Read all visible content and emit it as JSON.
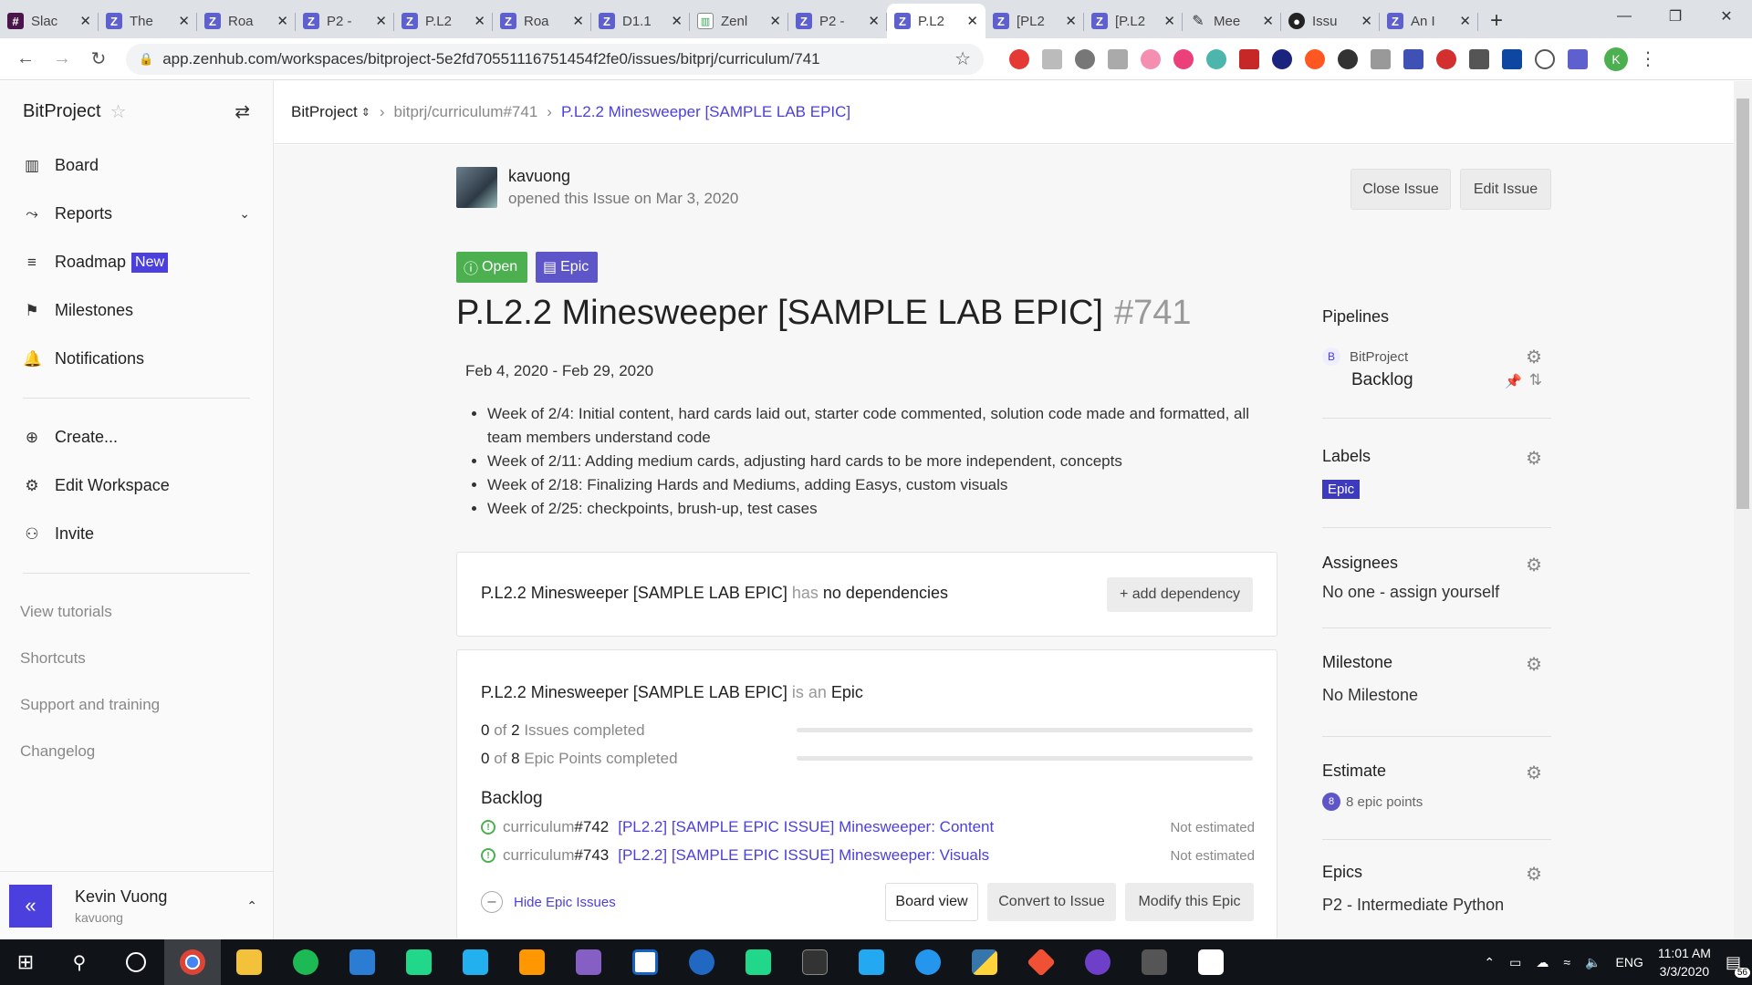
{
  "browser": {
    "tabs": [
      {
        "title": "Slac",
        "icon": "slack-icon"
      },
      {
        "title": "The",
        "icon": "zenhub-icon"
      },
      {
        "title": "Roa",
        "icon": "zenhub-icon"
      },
      {
        "title": "P2 -",
        "icon": "zenhub-icon"
      },
      {
        "title": "P.L2",
        "icon": "zenhub-icon"
      },
      {
        "title": "Roa",
        "icon": "zenhub-icon"
      },
      {
        "title": "D1.1",
        "icon": "zenhub-icon"
      },
      {
        "title": "Zenl",
        "icon": "chart-icon"
      },
      {
        "title": "P2 -",
        "icon": "zenhub-icon"
      },
      {
        "title": "P.L2",
        "icon": "zenhub-icon",
        "active": true
      },
      {
        "title": "[PL2",
        "icon": "zenhub-icon"
      },
      {
        "title": "[P.L2",
        "icon": "zenhub-icon"
      },
      {
        "title": "Mee",
        "icon": "pencil-icon"
      },
      {
        "title": "Issu",
        "icon": "github-icon"
      },
      {
        "title": "An I",
        "icon": "zenhub-icon"
      }
    ],
    "url": "app.zenhub.com/workspaces/bitproject-5e2fd70551116751454f2fe0/issues/bitprj/curriculum/741",
    "profile_initial": "K"
  },
  "sidebar": {
    "workspace": "BitProject",
    "nav": [
      {
        "label": "Board",
        "icon": "board-icon"
      },
      {
        "label": "Reports",
        "icon": "reports-icon"
      },
      {
        "label": "Roadmap",
        "icon": "roadmap-icon",
        "badge": "New"
      },
      {
        "label": "Milestones",
        "icon": "milestone-icon"
      },
      {
        "label": "Notifications",
        "icon": "bell-icon"
      }
    ],
    "actions": [
      {
        "label": "Create...",
        "icon": "plus-circle-icon"
      },
      {
        "label": "Edit Workspace",
        "icon": "gear-icon"
      },
      {
        "label": "Invite",
        "icon": "add-person-icon"
      }
    ],
    "links": [
      "View tutorials",
      "Shortcuts",
      "Support and training",
      "Changelog"
    ],
    "user": {
      "name": "Kevin Vuong",
      "handle": "kavuong"
    }
  },
  "breadcrumb": {
    "workspace": "BitProject",
    "repo": "bitprj/curriculum#741",
    "issue": "P.L2.2 Minesweeper [SAMPLE LAB EPIC]"
  },
  "issue": {
    "author": "kavuong",
    "opened": "opened this Issue on Mar 3, 2020",
    "close_btn": "Close Issue",
    "edit_btn": "Edit Issue",
    "status": "Open",
    "type": "Epic",
    "title": "P.L2.2 Minesweeper [SAMPLE LAB EPIC]",
    "number": "#741",
    "dates": "Feb 4, 2020 - Feb 29, 2020",
    "body": [
      "Week of 2/4: Initial content, hard cards laid out, starter code commented, solution code made and formatted, all team members understand code",
      "Week of 2/11: Adding medium cards, adjusting hard cards to be more independent, concepts",
      "Week of 2/18: Finalizing Hards and Mediums, adding Easys, custom visuals",
      "Week of 2/25: checkpoints, brush-up, test cases"
    ]
  },
  "dependencies": {
    "name": "P.L2.2 Minesweeper [SAMPLE LAB EPIC]",
    "has": "has",
    "status": "no dependencies",
    "add_btn": "+ add dependency"
  },
  "epic": {
    "name": "P.L2.2 Minesweeper [SAMPLE LAB EPIC]",
    "is_an": "is an",
    "kind": "Epic",
    "issues_done": "0",
    "issues_of": "of",
    "issues_total": "2",
    "issues_label": "Issues completed",
    "issues_progress": 0,
    "points_done": "0",
    "points_of": "of",
    "points_total": "8",
    "points_label": "Epic Points completed",
    "points_progress": 0,
    "backlog_label": "Backlog",
    "issues": [
      {
        "repo": "curriculum",
        "num": "#742",
        "title": "[PL2.2] [SAMPLE EPIC ISSUE] Minesweeper: Content",
        "estimate": "Not estimated"
      },
      {
        "repo": "curriculum",
        "num": "#743",
        "title": "[PL2.2] [SAMPLE EPIC ISSUE] Minesweeper: Visuals",
        "estimate": "Not estimated"
      }
    ],
    "hide_label": "Hide Epic Issues",
    "board_view": "Board view",
    "convert": "Convert to Issue",
    "modify": "Modify this Epic"
  },
  "panel": {
    "pipelines_title": "Pipelines",
    "pipeline_ws_initial": "B",
    "pipeline_ws": "BitProject",
    "pipeline_name": "Backlog",
    "labels_title": "Labels",
    "label": "Epic",
    "assignees_title": "Assignees",
    "assignees_val": "No one - assign yourself",
    "milestone_title": "Milestone",
    "milestone_val": "No Milestone",
    "estimate_title": "Estimate",
    "estimate_badge": "8",
    "estimate_val": "8 epic points",
    "epics_title": "Epics",
    "epics_val": "P2 - Intermediate Python"
  },
  "taskbar": {
    "lang": "ENG",
    "time": "11:01 AM",
    "date": "3/3/2020",
    "notifications": "56"
  },
  "colors": {
    "accent": "#4b3fde",
    "open": "#4caf50",
    "epic": "#5e55c9"
  }
}
